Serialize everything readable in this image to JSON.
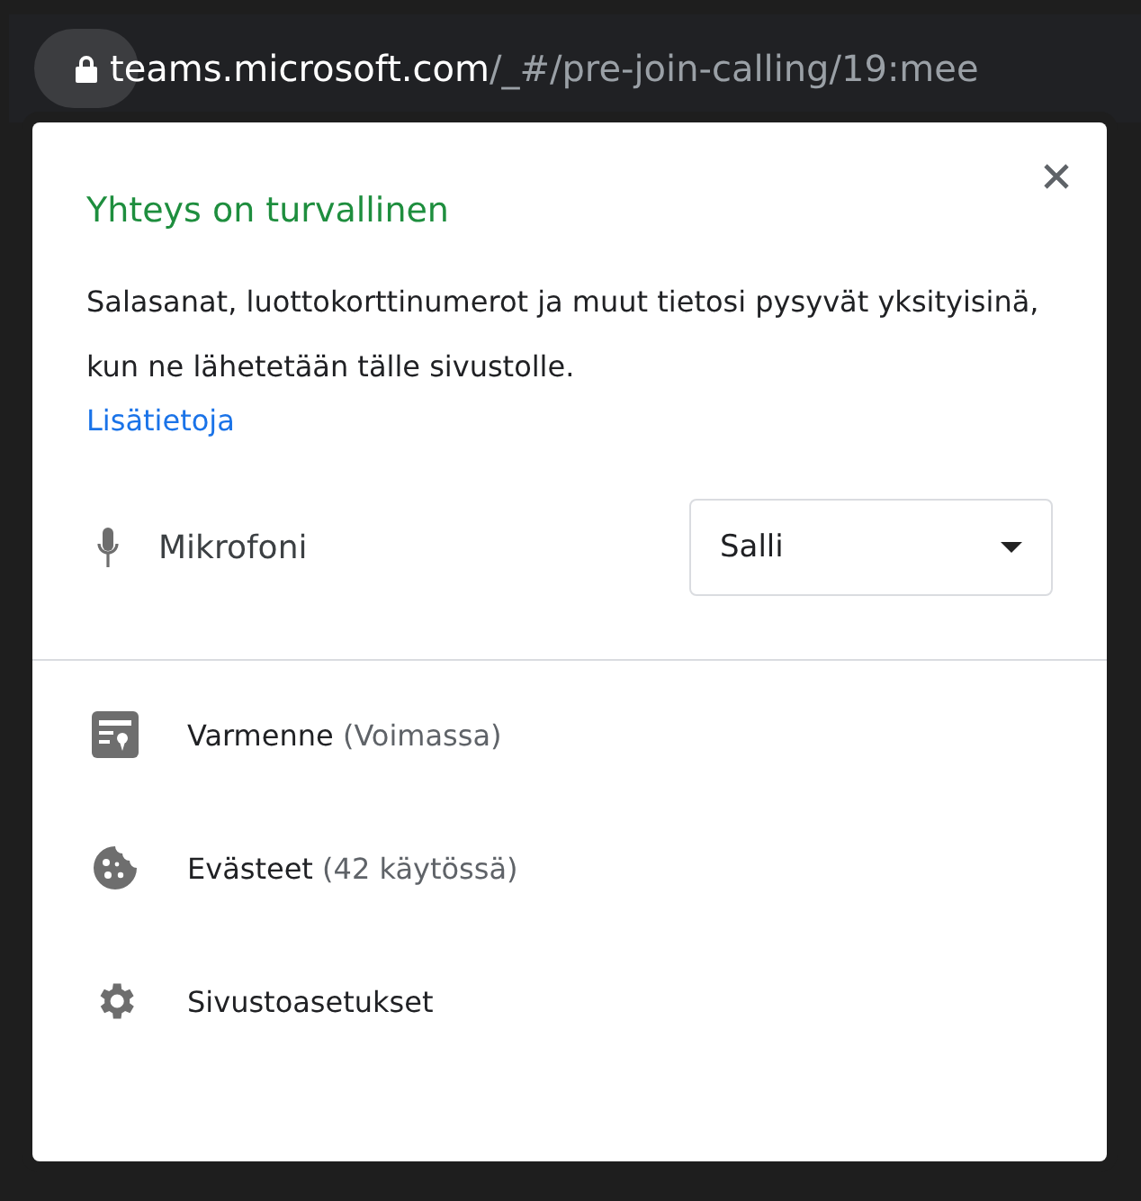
{
  "address_bar": {
    "host": "teams.microsoft.com",
    "path": "/_#/pre-join-calling/19:mee"
  },
  "popup": {
    "title": "Yhteys on turvallinen",
    "description": "Salasanat, luottokorttinumerot ja muut tietosi pysyvät yksityisinä, kun ne lähetetään tälle sivustolle.",
    "link": "Lisätietoja",
    "permission": {
      "label": "Mikrofoni",
      "value": "Salli"
    },
    "items": [
      {
        "kind": "certificate",
        "label": "Varmenne",
        "detail": "(Voimassa)"
      },
      {
        "kind": "cookies",
        "label": "Evästeet",
        "detail": "(42 käytössä)"
      },
      {
        "kind": "settings",
        "label": "Sivustoasetukset"
      }
    ]
  }
}
